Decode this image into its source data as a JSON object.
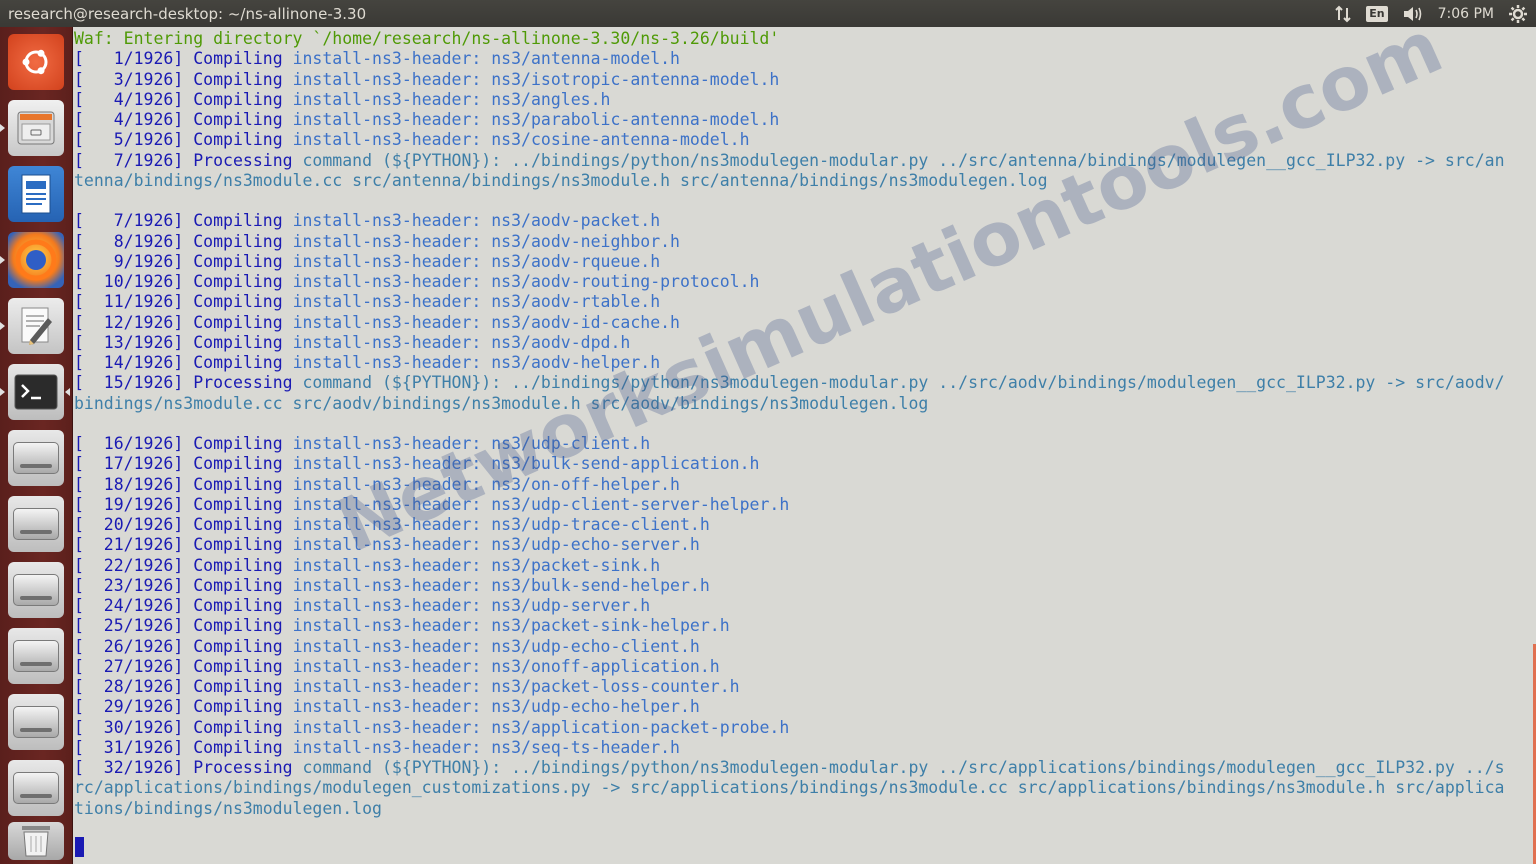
{
  "window": {
    "title": "research@research-desktop: ~/ns-allinone-3.30"
  },
  "panel": {
    "network_icon": "network-updown-icon",
    "keyboard_layout": "En",
    "volume_icon": "speaker-icon",
    "clock": "7:06 PM",
    "settings_icon": "gear-icon"
  },
  "launcher": {
    "items": [
      {
        "name": "ubuntu-dash",
        "icon": "ubuntu-logo-icon"
      },
      {
        "name": "files",
        "icon": "file-cabinet-icon"
      },
      {
        "name": "libreoffice-writer",
        "icon": "document-icon"
      },
      {
        "name": "firefox",
        "icon": "firefox-icon"
      },
      {
        "name": "text-editor",
        "icon": "notepad-pencil-icon"
      },
      {
        "name": "terminal",
        "icon": "terminal-icon"
      },
      {
        "name": "drive-1",
        "icon": "drive-icon"
      },
      {
        "name": "drive-2",
        "icon": "drive-icon"
      },
      {
        "name": "drive-3",
        "icon": "drive-icon"
      },
      {
        "name": "drive-4",
        "icon": "drive-icon"
      },
      {
        "name": "drive-5",
        "icon": "drive-icon"
      },
      {
        "name": "drive-6",
        "icon": "drive-icon"
      },
      {
        "name": "trash",
        "icon": "trash-icon"
      }
    ]
  },
  "terminal": {
    "lines": [
      {
        "kind": "waf",
        "text": "Waf: Entering directory `/home/research/ns-allinone-3.30/ns-3.26/build'"
      },
      {
        "kind": "compile",
        "prefix": "[   1/1926]",
        "action": "Compiling",
        "task": "install-ns3-header:",
        "target": "ns3/antenna-model.h"
      },
      {
        "kind": "compile",
        "prefix": "[   3/1926]",
        "action": "Compiling",
        "task": "install-ns3-header:",
        "target": "ns3/isotropic-antenna-model.h"
      },
      {
        "kind": "compile",
        "prefix": "[   4/1926]",
        "action": "Compiling",
        "task": "install-ns3-header:",
        "target": "ns3/angles.h"
      },
      {
        "kind": "compile",
        "prefix": "[   4/1926]",
        "action": "Compiling",
        "task": "install-ns3-header:",
        "target": "ns3/parabolic-antenna-model.h"
      },
      {
        "kind": "compile",
        "prefix": "[   5/1926]",
        "action": "Compiling",
        "task": "install-ns3-header:",
        "target": "ns3/cosine-antenna-model.h"
      },
      {
        "kind": "process",
        "prefix": "[   7/1926]",
        "action": "Processing",
        "task": "command (${PYTHON}):",
        "target": "../bindings/python/ns3modulegen-modular.py ../src/antenna/bindings/modulegen__gcc_ILP32.py -> src/an"
      },
      {
        "kind": "cont",
        "text": "tenna/bindings/ns3module.cc src/antenna/bindings/ns3module.h src/antenna/bindings/ns3modulegen.log"
      },
      {
        "kind": "blank",
        "text": ""
      },
      {
        "kind": "compile",
        "prefix": "[   7/1926]",
        "action": "Compiling",
        "task": "install-ns3-header:",
        "target": "ns3/aodv-packet.h"
      },
      {
        "kind": "compile",
        "prefix": "[   8/1926]",
        "action": "Compiling",
        "task": "install-ns3-header:",
        "target": "ns3/aodv-neighbor.h"
      },
      {
        "kind": "compile",
        "prefix": "[   9/1926]",
        "action": "Compiling",
        "task": "install-ns3-header:",
        "target": "ns3/aodv-rqueue.h"
      },
      {
        "kind": "compile",
        "prefix": "[  10/1926]",
        "action": "Compiling",
        "task": "install-ns3-header:",
        "target": "ns3/aodv-routing-protocol.h"
      },
      {
        "kind": "compile",
        "prefix": "[  11/1926]",
        "action": "Compiling",
        "task": "install-ns3-header:",
        "target": "ns3/aodv-rtable.h"
      },
      {
        "kind": "compile",
        "prefix": "[  12/1926]",
        "action": "Compiling",
        "task": "install-ns3-header:",
        "target": "ns3/aodv-id-cache.h"
      },
      {
        "kind": "compile",
        "prefix": "[  13/1926]",
        "action": "Compiling",
        "task": "install-ns3-header:",
        "target": "ns3/aodv-dpd.h"
      },
      {
        "kind": "compile",
        "prefix": "[  14/1926]",
        "action": "Compiling",
        "task": "install-ns3-header:",
        "target": "ns3/aodv-helper.h"
      },
      {
        "kind": "process",
        "prefix": "[  15/1926]",
        "action": "Processing",
        "task": "command (${PYTHON}):",
        "target": "../bindings/python/ns3modulegen-modular.py ../src/aodv/bindings/modulegen__gcc_ILP32.py -> src/aodv/"
      },
      {
        "kind": "cont",
        "text": "bindings/ns3module.cc src/aodv/bindings/ns3module.h src/aodv/bindings/ns3modulegen.log"
      },
      {
        "kind": "blank",
        "text": ""
      },
      {
        "kind": "compile",
        "prefix": "[  16/1926]",
        "action": "Compiling",
        "task": "install-ns3-header:",
        "target": "ns3/udp-client.h"
      },
      {
        "kind": "compile",
        "prefix": "[  17/1926]",
        "action": "Compiling",
        "task": "install-ns3-header:",
        "target": "ns3/bulk-send-application.h"
      },
      {
        "kind": "compile",
        "prefix": "[  18/1926]",
        "action": "Compiling",
        "task": "install-ns3-header:",
        "target": "ns3/on-off-helper.h"
      },
      {
        "kind": "compile",
        "prefix": "[  19/1926]",
        "action": "Compiling",
        "task": "install-ns3-header:",
        "target": "ns3/udp-client-server-helper.h"
      },
      {
        "kind": "compile",
        "prefix": "[  20/1926]",
        "action": "Compiling",
        "task": "install-ns3-header:",
        "target": "ns3/udp-trace-client.h"
      },
      {
        "kind": "compile",
        "prefix": "[  21/1926]",
        "action": "Compiling",
        "task": "install-ns3-header:",
        "target": "ns3/udp-echo-server.h"
      },
      {
        "kind": "compile",
        "prefix": "[  22/1926]",
        "action": "Compiling",
        "task": "install-ns3-header:",
        "target": "ns3/packet-sink.h"
      },
      {
        "kind": "compile",
        "prefix": "[  23/1926]",
        "action": "Compiling",
        "task": "install-ns3-header:",
        "target": "ns3/bulk-send-helper.h"
      },
      {
        "kind": "compile",
        "prefix": "[  24/1926]",
        "action": "Compiling",
        "task": "install-ns3-header:",
        "target": "ns3/udp-server.h"
      },
      {
        "kind": "compile",
        "prefix": "[  25/1926]",
        "action": "Compiling",
        "task": "install-ns3-header:",
        "target": "ns3/packet-sink-helper.h"
      },
      {
        "kind": "compile",
        "prefix": "[  26/1926]",
        "action": "Compiling",
        "task": "install-ns3-header:",
        "target": "ns3/udp-echo-client.h"
      },
      {
        "kind": "compile",
        "prefix": "[  27/1926]",
        "action": "Compiling",
        "task": "install-ns3-header:",
        "target": "ns3/onoff-application.h"
      },
      {
        "kind": "compile",
        "prefix": "[  28/1926]",
        "action": "Compiling",
        "task": "install-ns3-header:",
        "target": "ns3/packet-loss-counter.h"
      },
      {
        "kind": "compile",
        "prefix": "[  29/1926]",
        "action": "Compiling",
        "task": "install-ns3-header:",
        "target": "ns3/udp-echo-helper.h"
      },
      {
        "kind": "compile",
        "prefix": "[  30/1926]",
        "action": "Compiling",
        "task": "install-ns3-header:",
        "target": "ns3/application-packet-probe.h"
      },
      {
        "kind": "compile",
        "prefix": "[  31/1926]",
        "action": "Compiling",
        "task": "install-ns3-header:",
        "target": "ns3/seq-ts-header.h"
      },
      {
        "kind": "process",
        "prefix": "[  32/1926]",
        "action": "Processing",
        "task": "command (${PYTHON}):",
        "target": "../bindings/python/ns3modulegen-modular.py ../src/applications/bindings/modulegen__gcc_ILP32.py ../s"
      },
      {
        "kind": "cont",
        "text": "rc/applications/bindings/modulegen_customizations.py -> src/applications/bindings/ns3module.cc src/applications/bindings/ns3module.h src/applica"
      },
      {
        "kind": "cont",
        "text": "tions/bindings/ns3modulegen.log"
      }
    ]
  },
  "watermark": {
    "text": "Networksimulationtools.com"
  },
  "colors": {
    "terminal_bg": "#d9d9d4",
    "waf_green": "#4f9a06",
    "bracket_navy": "#1a1ab3",
    "header_blue": "#3d72c8",
    "launcher_bg": "#6a2622",
    "panel_bg": "#3a3935"
  }
}
